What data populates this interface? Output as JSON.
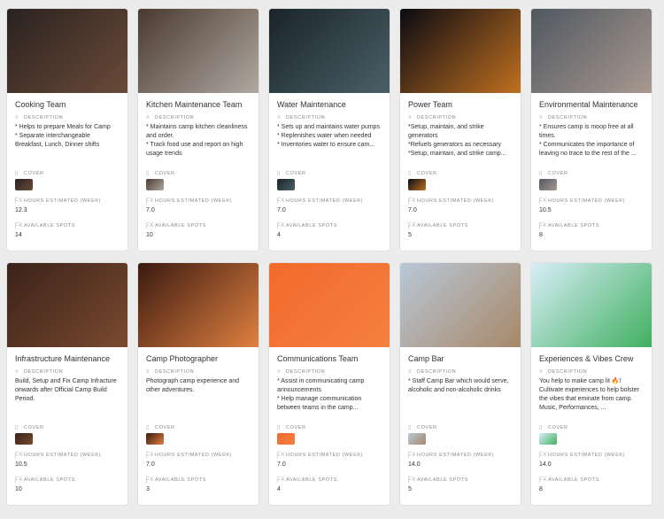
{
  "labels": {
    "description": "Description",
    "cover": "Cover",
    "hours": "Hours Estimated (Week)",
    "spots": "Available Spots"
  },
  "cards": [
    {
      "title": "Cooking Team",
      "description": "* Helps to prepare Meals for Camp\n* Separate interchangeable Breakfast, Lunch, Dinner shifts",
      "hours": "12.3",
      "spots": "14",
      "colors": [
        "#2a2220",
        "#6a4a38"
      ]
    },
    {
      "title": "Kitchen Maintenance Team",
      "description": "* Maintains camp kitchen cleanliness and order.\n* Track food use and report on high usage trends",
      "hours": "7.0",
      "spots": "10",
      "colors": [
        "#4a3a30",
        "#b0a8a0"
      ]
    },
    {
      "title": "Water Maintenance",
      "description": "* Sets up and maintains water pumps\n* Replenishes water when needed\n* Inventories water to ensure cam...",
      "hours": "7.0",
      "spots": "4",
      "colors": [
        "#1a2428",
        "#4a6068"
      ]
    },
    {
      "title": "Power Team",
      "description": "*Setup, maintain, and strike generators\n*Refuels generators as necessary\n*Setup, maintain, and strike camp...",
      "hours": "7.0",
      "spots": "5",
      "colors": [
        "#0a0a12",
        "#c07020"
      ]
    },
    {
      "title": "Environmental Maintenance",
      "description": "* Ensures camp is moop free at all times.\n* Communicates the importance of leaving no trace to the rest of the ...",
      "hours": "10.5",
      "spots": "8",
      "colors": [
        "#505860",
        "#a89890"
      ]
    },
    {
      "title": "Infrastructure Maintenance",
      "description": "Build, Setup and Fix Camp Infracture onwards after Official Camp Build Period.",
      "hours": "10.5",
      "spots": "10",
      "colors": [
        "#3a2218",
        "#7a4a30"
      ]
    },
    {
      "title": "Camp Photographer",
      "description": "Photograph camp experience and other adventures.",
      "hours": "7.0",
      "spots": "3",
      "colors": [
        "#3a1a10",
        "#e08040"
      ]
    },
    {
      "title": "Communications Team",
      "description": "* Assist in communicating camp announcements\n* Help manage communication between teams in the camp...",
      "hours": "7.0",
      "spots": "4",
      "colors": [
        "#f26a2c",
        "#f58040"
      ]
    },
    {
      "title": "Camp Bar",
      "description": "* Staff Camp Bar which would serve, alcoholic and non-alcoholic drinks",
      "hours": "14.0",
      "spots": "5",
      "colors": [
        "#b8c8d8",
        "#a88868"
      ]
    },
    {
      "title": "Experiences & Vibes Crew",
      "description": "You help to make camp lit 🔥! Cultivate experiences to help bolster the vibes that eminate from camp. Music, Performances, ...",
      "hours": "14.0",
      "spots": "8",
      "colors": [
        "#d8eef8",
        "#40b060"
      ]
    }
  ]
}
